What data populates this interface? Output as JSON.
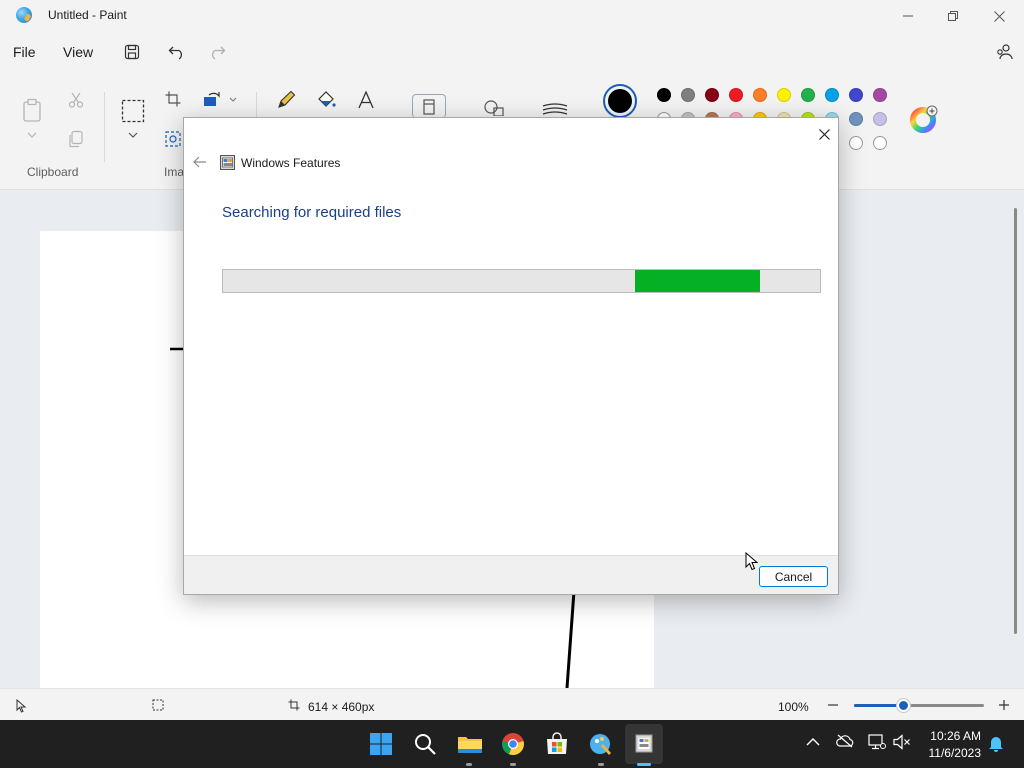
{
  "window": {
    "title": "Untitled - Paint"
  },
  "menu": {
    "file": "File",
    "view": "View"
  },
  "ribbon": {
    "clipboard_label": "Clipboard",
    "image_label_partial": "Ima"
  },
  "palette": {
    "primary_color": "#000000",
    "row1": [
      "#000000",
      "#7f7f7f",
      "#880015",
      "#ed1c24",
      "#ff7f27",
      "#fff200",
      "#22b14c",
      "#00a2e8",
      "#3f48cc",
      "#a349a4"
    ],
    "row2_visible": [
      "#ffffff",
      "#c3c3c3",
      "#b97a57",
      "#ffaec9",
      "#ffc90e",
      "#efe4b0",
      "#b5e61d",
      "#99d9ea",
      "#7092be",
      "#c8bfe7"
    ],
    "row3_visible": [
      "#ffffff",
      "#ffffff"
    ]
  },
  "dialog": {
    "title": "Windows Features",
    "heading": "Searching for required files",
    "progress_segment_start": 0.69,
    "progress_segment_end": 0.9,
    "progress_color": "#06b025",
    "cancel_label": "Cancel"
  },
  "status": {
    "canvas_size": "614 × 460px",
    "zoom": "100%",
    "zoom_slider_fraction": 0.38
  },
  "taskbar": {
    "time": "10:26 AM",
    "date": "11/6/2023"
  }
}
